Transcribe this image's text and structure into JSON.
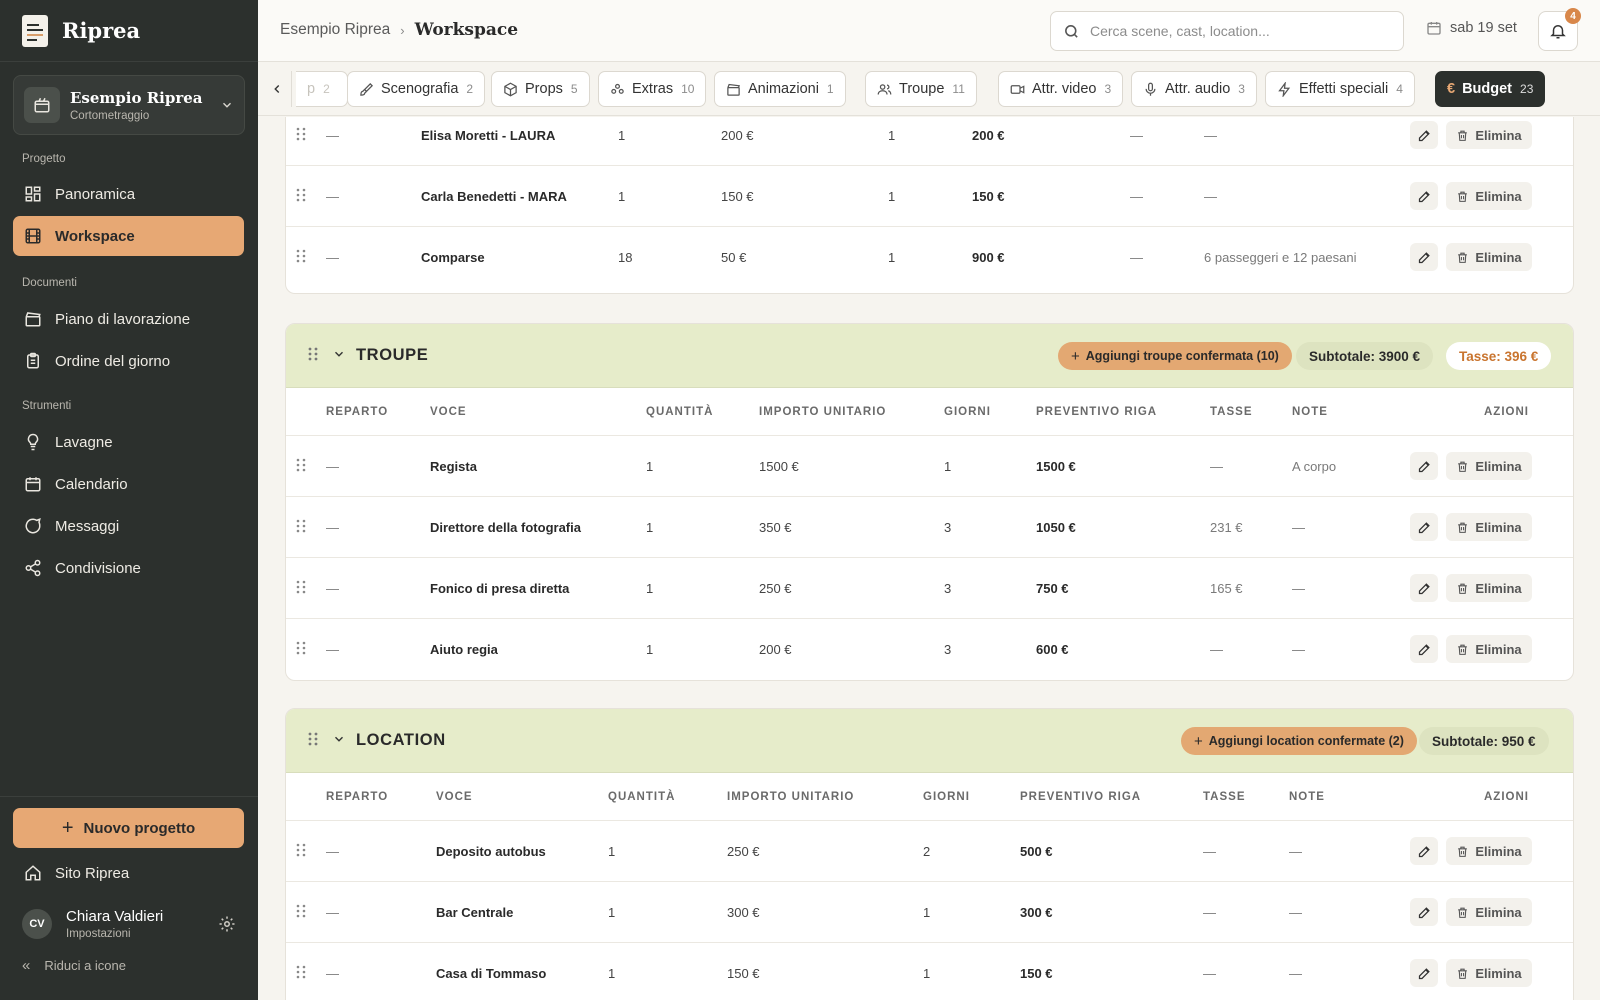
{
  "app": {
    "name": "Riprea"
  },
  "sidebar": {
    "project": {
      "name": "Esempio Riprea",
      "type": "Cortometraggio"
    },
    "sections": {
      "progetto": "Progetto",
      "documenti": "Documenti",
      "strumenti": "Strumenti"
    },
    "items": {
      "panoramica": "Panoramica",
      "workspace": "Workspace",
      "piano": "Piano di lavorazione",
      "ordine": "Ordine del giorno",
      "lavagne": "Lavagne",
      "calendario": "Calendario",
      "messaggi": "Messaggi",
      "condivisione": "Condivisione"
    },
    "new_project": "Nuovo progetto",
    "site": "Sito Riprea",
    "user": {
      "initials": "CV",
      "name": "Chiara Valdieri",
      "sub": "Impostazioni"
    },
    "collapse": "Riduci a icone"
  },
  "header": {
    "breadcrumb_root": "Esempio Riprea",
    "breadcrumb_current": "Workspace",
    "search_placeholder": "Cerca scene, cast, location...",
    "date": "sab 19 set",
    "notifications": "4"
  },
  "tabs": [
    {
      "label": "p",
      "count": "2",
      "icon": "none"
    },
    {
      "label": "Scenografia",
      "count": "2",
      "icon": "brush-icon"
    },
    {
      "label": "Props",
      "count": "5",
      "icon": "box-icon"
    },
    {
      "label": "Extras",
      "count": "10",
      "icon": "users-group-icon"
    },
    {
      "label": "Animazioni",
      "count": "1",
      "icon": "clapper-icon"
    },
    {
      "label": "Troupe",
      "count": "11",
      "icon": "users-icon"
    },
    {
      "label": "Attr. video",
      "count": "3",
      "icon": "video-icon"
    },
    {
      "label": "Attr. audio",
      "count": "3",
      "icon": "mic-icon"
    },
    {
      "label": "Effetti speciali",
      "count": "4",
      "icon": "bolt-icon"
    },
    {
      "label": "Budget",
      "count": "23",
      "icon": "euro-icon"
    }
  ],
  "labels": {
    "delete": "Elimina"
  },
  "cast_rows": [
    {
      "reparto": "—",
      "voce": "Elisa Moretti - LAURA",
      "quantita": "1",
      "importo": "200 €",
      "giorni": "1",
      "preventivo": "200 €",
      "tasse": "—",
      "note": "—"
    },
    {
      "reparto": "—",
      "voce": "Carla Benedetti - MARA",
      "quantita": "1",
      "importo": "150 €",
      "giorni": "1",
      "preventivo": "150 €",
      "tasse": "—",
      "note": "—"
    },
    {
      "reparto": "—",
      "voce": "Comparse",
      "quantita": "18",
      "importo": "50 €",
      "giorni": "1",
      "preventivo": "900 €",
      "tasse": "—",
      "note": "6 passeggeri e 12 paesani"
    }
  ],
  "troupe": {
    "title": "TROUPE",
    "add_label": "Aggiungi troupe confermata (10)",
    "subtotal": "Subtotale: 3900 €",
    "taxes": "Tasse: 396 €",
    "columns": {
      "reparto": "REPARTO",
      "voce": "VOCE",
      "quantita": "QUANTITÀ",
      "importo": "IMPORTO UNITARIO",
      "giorni": "GIORNI",
      "preventivo": "PREVENTIVO RIGA",
      "tasse": "TASSE",
      "note": "NOTE",
      "azioni": "AZIONI"
    },
    "rows": [
      {
        "reparto": "—",
        "voce": "Regista",
        "quantita": "1",
        "importo": "1500 €",
        "giorni": "1",
        "preventivo": "1500 €",
        "tasse": "—",
        "note": "A corpo"
      },
      {
        "reparto": "—",
        "voce": "Direttore della fotografia",
        "quantita": "1",
        "importo": "350 €",
        "giorni": "3",
        "preventivo": "1050 €",
        "tasse": "231 €",
        "note": "—"
      },
      {
        "reparto": "—",
        "voce": "Fonico di presa diretta",
        "quantita": "1",
        "importo": "250 €",
        "giorni": "3",
        "preventivo": "750 €",
        "tasse": "165 €",
        "note": "—"
      },
      {
        "reparto": "—",
        "voce": "Aiuto regia",
        "quantita": "1",
        "importo": "200 €",
        "giorni": "3",
        "preventivo": "600 €",
        "tasse": "—",
        "note": "—"
      }
    ]
  },
  "location": {
    "title": "LOCATION",
    "add_label": "Aggiungi location confermate (2)",
    "subtotal": "Subtotale: 950 €",
    "columns": {
      "reparto": "REPARTO",
      "voce": "VOCE",
      "quantita": "QUANTITÀ",
      "importo": "IMPORTO UNITARIO",
      "giorni": "GIORNI",
      "preventivo": "PREVENTIVO RIGA",
      "tasse": "TASSE",
      "note": "NOTE",
      "azioni": "AZIONI"
    },
    "rows": [
      {
        "reparto": "—",
        "voce": "Deposito autobus",
        "quantita": "1",
        "importo": "250 €",
        "giorni": "2",
        "preventivo": "500 €",
        "tasse": "—",
        "note": "—"
      },
      {
        "reparto": "—",
        "voce": "Bar Centrale",
        "quantita": "1",
        "importo": "300 €",
        "giorni": "1",
        "preventivo": "300 €",
        "tasse": "—",
        "note": "—"
      },
      {
        "reparto": "—",
        "voce": "Casa di Tommaso",
        "quantita": "1",
        "importo": "150 €",
        "giorni": "1",
        "preventivo": "150 €",
        "tasse": "—",
        "note": "—"
      }
    ]
  },
  "colors": {
    "accent": "#e7a874",
    "sidebar": "#2c302d",
    "group_header": "#e6ecca",
    "tax_text": "#c9742e"
  }
}
